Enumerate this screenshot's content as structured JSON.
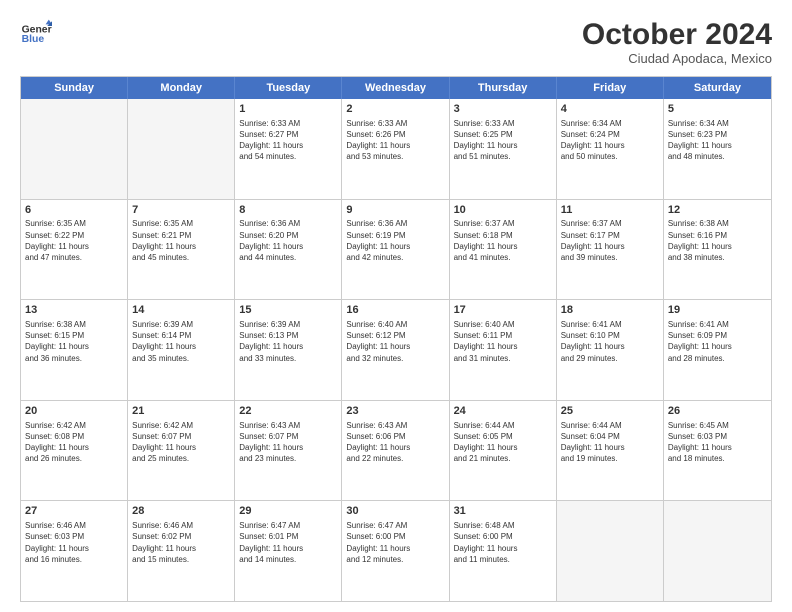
{
  "header": {
    "logo_line1": "General",
    "logo_line2": "Blue",
    "month": "October 2024",
    "location": "Ciudad Apodaca, Mexico"
  },
  "weekdays": [
    "Sunday",
    "Monday",
    "Tuesday",
    "Wednesday",
    "Thursday",
    "Friday",
    "Saturday"
  ],
  "rows": [
    [
      {
        "day": "",
        "empty": true
      },
      {
        "day": "",
        "empty": true
      },
      {
        "day": "1",
        "line1": "Sunrise: 6:33 AM",
        "line2": "Sunset: 6:27 PM",
        "line3": "Daylight: 11 hours",
        "line4": "and 54 minutes."
      },
      {
        "day": "2",
        "line1": "Sunrise: 6:33 AM",
        "line2": "Sunset: 6:26 PM",
        "line3": "Daylight: 11 hours",
        "line4": "and 53 minutes."
      },
      {
        "day": "3",
        "line1": "Sunrise: 6:33 AM",
        "line2": "Sunset: 6:25 PM",
        "line3": "Daylight: 11 hours",
        "line4": "and 51 minutes."
      },
      {
        "day": "4",
        "line1": "Sunrise: 6:34 AM",
        "line2": "Sunset: 6:24 PM",
        "line3": "Daylight: 11 hours",
        "line4": "and 50 minutes."
      },
      {
        "day": "5",
        "line1": "Sunrise: 6:34 AM",
        "line2": "Sunset: 6:23 PM",
        "line3": "Daylight: 11 hours",
        "line4": "and 48 minutes."
      }
    ],
    [
      {
        "day": "6",
        "line1": "Sunrise: 6:35 AM",
        "line2": "Sunset: 6:22 PM",
        "line3": "Daylight: 11 hours",
        "line4": "and 47 minutes."
      },
      {
        "day": "7",
        "line1": "Sunrise: 6:35 AM",
        "line2": "Sunset: 6:21 PM",
        "line3": "Daylight: 11 hours",
        "line4": "and 45 minutes."
      },
      {
        "day": "8",
        "line1": "Sunrise: 6:36 AM",
        "line2": "Sunset: 6:20 PM",
        "line3": "Daylight: 11 hours",
        "line4": "and 44 minutes."
      },
      {
        "day": "9",
        "line1": "Sunrise: 6:36 AM",
        "line2": "Sunset: 6:19 PM",
        "line3": "Daylight: 11 hours",
        "line4": "and 42 minutes."
      },
      {
        "day": "10",
        "line1": "Sunrise: 6:37 AM",
        "line2": "Sunset: 6:18 PM",
        "line3": "Daylight: 11 hours",
        "line4": "and 41 minutes."
      },
      {
        "day": "11",
        "line1": "Sunrise: 6:37 AM",
        "line2": "Sunset: 6:17 PM",
        "line3": "Daylight: 11 hours",
        "line4": "and 39 minutes."
      },
      {
        "day": "12",
        "line1": "Sunrise: 6:38 AM",
        "line2": "Sunset: 6:16 PM",
        "line3": "Daylight: 11 hours",
        "line4": "and 38 minutes."
      }
    ],
    [
      {
        "day": "13",
        "line1": "Sunrise: 6:38 AM",
        "line2": "Sunset: 6:15 PM",
        "line3": "Daylight: 11 hours",
        "line4": "and 36 minutes."
      },
      {
        "day": "14",
        "line1": "Sunrise: 6:39 AM",
        "line2": "Sunset: 6:14 PM",
        "line3": "Daylight: 11 hours",
        "line4": "and 35 minutes."
      },
      {
        "day": "15",
        "line1": "Sunrise: 6:39 AM",
        "line2": "Sunset: 6:13 PM",
        "line3": "Daylight: 11 hours",
        "line4": "and 33 minutes."
      },
      {
        "day": "16",
        "line1": "Sunrise: 6:40 AM",
        "line2": "Sunset: 6:12 PM",
        "line3": "Daylight: 11 hours",
        "line4": "and 32 minutes."
      },
      {
        "day": "17",
        "line1": "Sunrise: 6:40 AM",
        "line2": "Sunset: 6:11 PM",
        "line3": "Daylight: 11 hours",
        "line4": "and 31 minutes."
      },
      {
        "day": "18",
        "line1": "Sunrise: 6:41 AM",
        "line2": "Sunset: 6:10 PM",
        "line3": "Daylight: 11 hours",
        "line4": "and 29 minutes."
      },
      {
        "day": "19",
        "line1": "Sunrise: 6:41 AM",
        "line2": "Sunset: 6:09 PM",
        "line3": "Daylight: 11 hours",
        "line4": "and 28 minutes."
      }
    ],
    [
      {
        "day": "20",
        "line1": "Sunrise: 6:42 AM",
        "line2": "Sunset: 6:08 PM",
        "line3": "Daylight: 11 hours",
        "line4": "and 26 minutes."
      },
      {
        "day": "21",
        "line1": "Sunrise: 6:42 AM",
        "line2": "Sunset: 6:07 PM",
        "line3": "Daylight: 11 hours",
        "line4": "and 25 minutes."
      },
      {
        "day": "22",
        "line1": "Sunrise: 6:43 AM",
        "line2": "Sunset: 6:07 PM",
        "line3": "Daylight: 11 hours",
        "line4": "and 23 minutes."
      },
      {
        "day": "23",
        "line1": "Sunrise: 6:43 AM",
        "line2": "Sunset: 6:06 PM",
        "line3": "Daylight: 11 hours",
        "line4": "and 22 minutes."
      },
      {
        "day": "24",
        "line1": "Sunrise: 6:44 AM",
        "line2": "Sunset: 6:05 PM",
        "line3": "Daylight: 11 hours",
        "line4": "and 21 minutes."
      },
      {
        "day": "25",
        "line1": "Sunrise: 6:44 AM",
        "line2": "Sunset: 6:04 PM",
        "line3": "Daylight: 11 hours",
        "line4": "and 19 minutes."
      },
      {
        "day": "26",
        "line1": "Sunrise: 6:45 AM",
        "line2": "Sunset: 6:03 PM",
        "line3": "Daylight: 11 hours",
        "line4": "and 18 minutes."
      }
    ],
    [
      {
        "day": "27",
        "line1": "Sunrise: 6:46 AM",
        "line2": "Sunset: 6:03 PM",
        "line3": "Daylight: 11 hours",
        "line4": "and 16 minutes."
      },
      {
        "day": "28",
        "line1": "Sunrise: 6:46 AM",
        "line2": "Sunset: 6:02 PM",
        "line3": "Daylight: 11 hours",
        "line4": "and 15 minutes."
      },
      {
        "day": "29",
        "line1": "Sunrise: 6:47 AM",
        "line2": "Sunset: 6:01 PM",
        "line3": "Daylight: 11 hours",
        "line4": "and 14 minutes."
      },
      {
        "day": "30",
        "line1": "Sunrise: 6:47 AM",
        "line2": "Sunset: 6:00 PM",
        "line3": "Daylight: 11 hours",
        "line4": "and 12 minutes."
      },
      {
        "day": "31",
        "line1": "Sunrise: 6:48 AM",
        "line2": "Sunset: 6:00 PM",
        "line3": "Daylight: 11 hours",
        "line4": "and 11 minutes."
      },
      {
        "day": "",
        "empty": true
      },
      {
        "day": "",
        "empty": true
      }
    ]
  ]
}
